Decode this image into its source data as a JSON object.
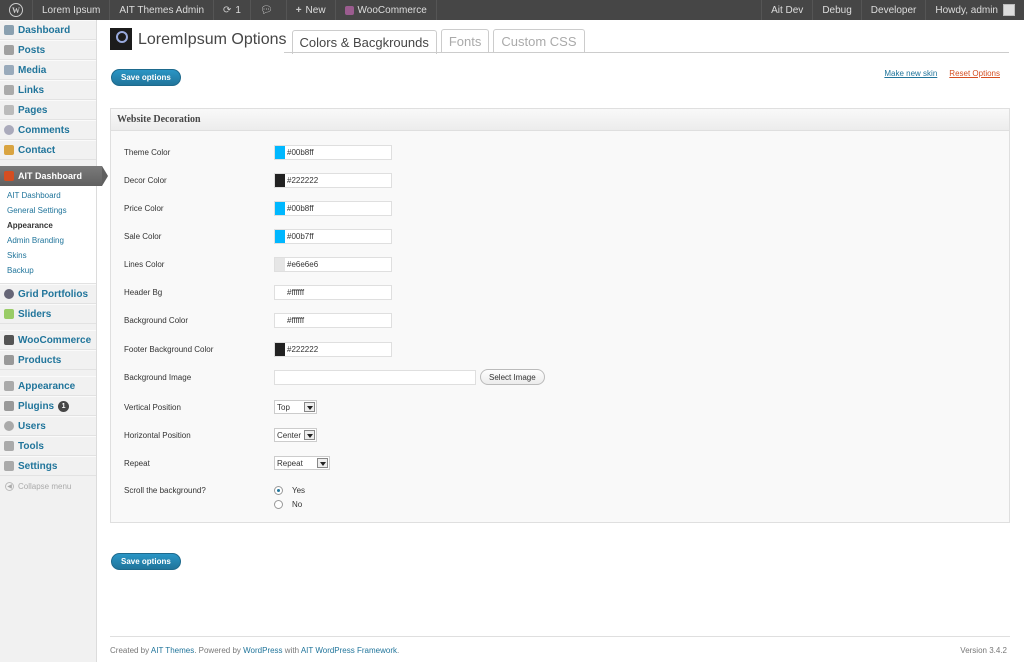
{
  "adminbar": {
    "site_name": "Lorem Ipsum",
    "ait_admin": "AIT Themes Admin",
    "updates_count": "1",
    "new_label": "New",
    "woocommerce": "WooCommerce",
    "right": [
      "Ait Dev",
      "Debug",
      "Developer"
    ],
    "howdy": "Howdy, admin"
  },
  "sidebar": {
    "group1": [
      "Dashboard",
      "Posts",
      "Media",
      "Links",
      "Pages",
      "Comments",
      "Contact"
    ],
    "ait_dashboard": "AIT Dashboard",
    "submenu": [
      "AIT Dashboard",
      "General Settings",
      "Appearance",
      "Admin Branding",
      "Skins",
      "Backup"
    ],
    "group2": [
      "Grid Portfolios",
      "Sliders"
    ],
    "group3": [
      "WooCommerce",
      "Products"
    ],
    "group4": [
      "Appearance",
      "Plugins",
      "Users",
      "Tools",
      "Settings"
    ],
    "plugins_badge": "1",
    "collapse": "Collapse menu"
  },
  "header": {
    "title": "LoremIpsum Options",
    "tabs": [
      "Colors & Bacgkrounds",
      "Fonts",
      "Custom CSS"
    ]
  },
  "actions": {
    "save": "Save options",
    "make_skin": "Make new skin",
    "reset": "Reset Options"
  },
  "panel": {
    "title": "Website Decoration",
    "colors": [
      {
        "label": "Theme Color",
        "value": "#00b8ff",
        "swatch": "#00b8ff"
      },
      {
        "label": "Decor Color",
        "value": "#222222",
        "swatch": "#222222"
      },
      {
        "label": "Price Color",
        "value": "#00b8ff",
        "swatch": "#00b8ff"
      },
      {
        "label": "Sale Color",
        "value": "#00b7ff",
        "swatch": "#00b7ff"
      },
      {
        "label": "Lines Color",
        "value": "#e6e6e6",
        "swatch": "#e6e6e6"
      },
      {
        "label": "Header Bg",
        "value": "#ffffff",
        "swatch": "#ffffff"
      },
      {
        "label": "Background Color",
        "value": "#ffffff",
        "swatch": "#ffffff"
      },
      {
        "label": "Footer Background Color",
        "value": "#222222",
        "swatch": "#222222"
      }
    ],
    "bg_image_label": "Background Image",
    "bg_image_value": "",
    "select_image": "Select Image",
    "vertical_label": "Vertical Position",
    "vertical_value": "Top",
    "horizontal_label": "Horizontal Position",
    "horizontal_value": "Center",
    "repeat_label": "Repeat",
    "repeat_value": "Repeat",
    "scroll_label": "Scroll the background?",
    "scroll_yes": "Yes",
    "scroll_no": "No"
  },
  "footer": {
    "created_by": "Created by",
    "ait_themes": "AIT Themes",
    "powered_by": ". Powered by",
    "wordpress": "WordPress",
    "with": "with",
    "framework": "AIT WordPress Framework",
    "end": ".",
    "version": "Version 3.4.2"
  }
}
